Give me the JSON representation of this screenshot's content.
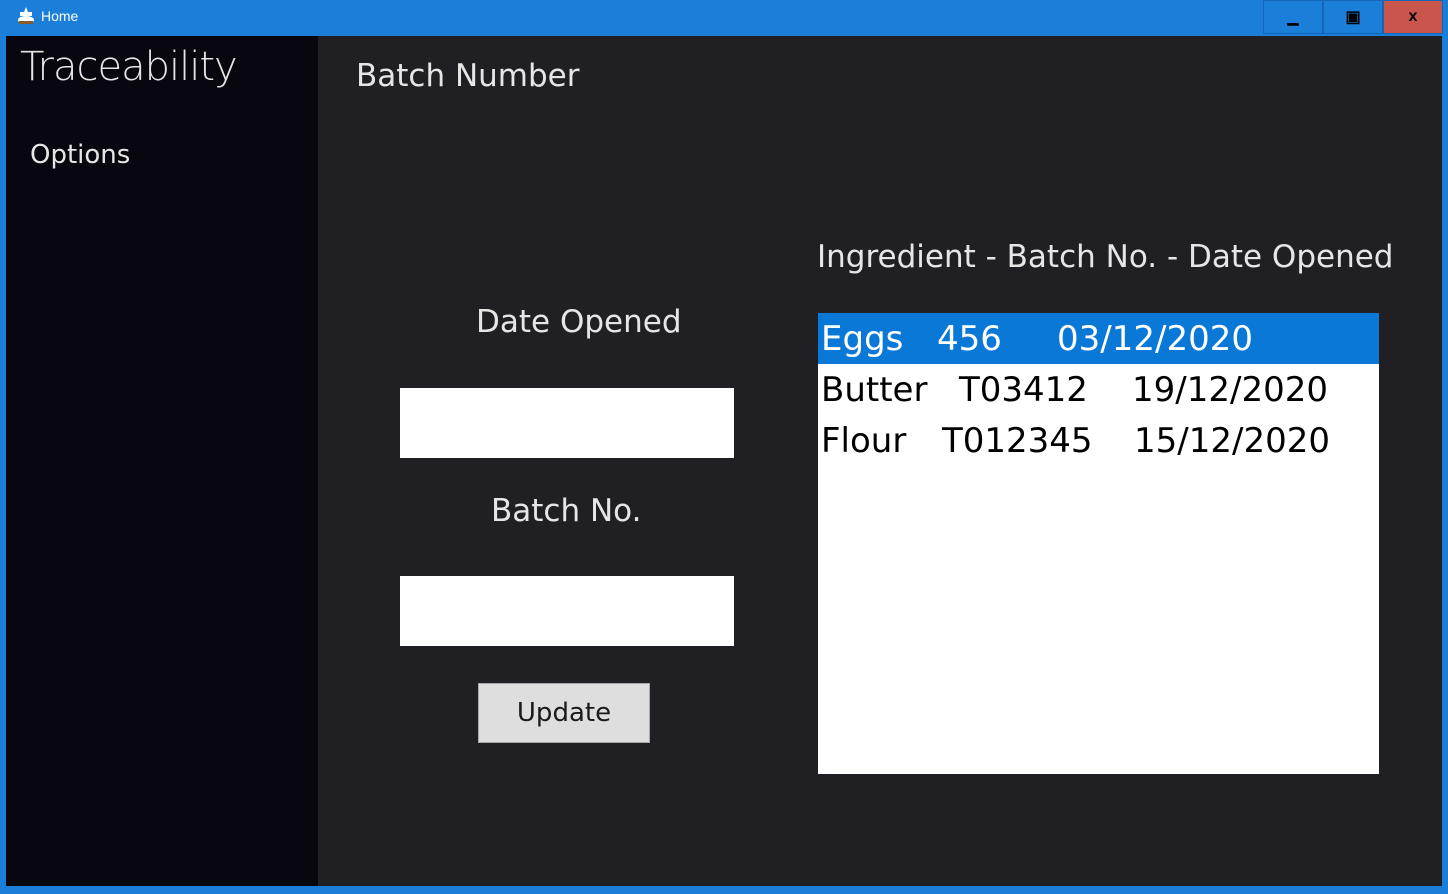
{
  "window": {
    "title": "Home",
    "minimize_glyph": "▁",
    "maximize_glyph": "▣",
    "close_glyph": "x",
    "accent_color": "#1b7fd9",
    "close_color": "#c9564c"
  },
  "sidebar": {
    "title": "Traceability",
    "items": [
      {
        "label": "Options"
      }
    ]
  },
  "main": {
    "page_title": "Batch Number",
    "date_label": "Date Opened",
    "date_value": "",
    "batch_label": "Batch No.",
    "batch_value": "",
    "update_label": "Update",
    "list_header": "Ingredient - Batch No. - Date Opened",
    "list_items": [
      {
        "ingredient": "Eggs",
        "batch": "456",
        "date": "03/12/2020",
        "selected": true
      },
      {
        "ingredient": "Butter",
        "batch": "T03412",
        "date": "19/12/2020",
        "selected": false
      },
      {
        "ingredient": "Flour",
        "batch": "T012345",
        "date": "15/12/2020",
        "selected": false
      }
    ],
    "selection_color": "#0a78d7"
  }
}
